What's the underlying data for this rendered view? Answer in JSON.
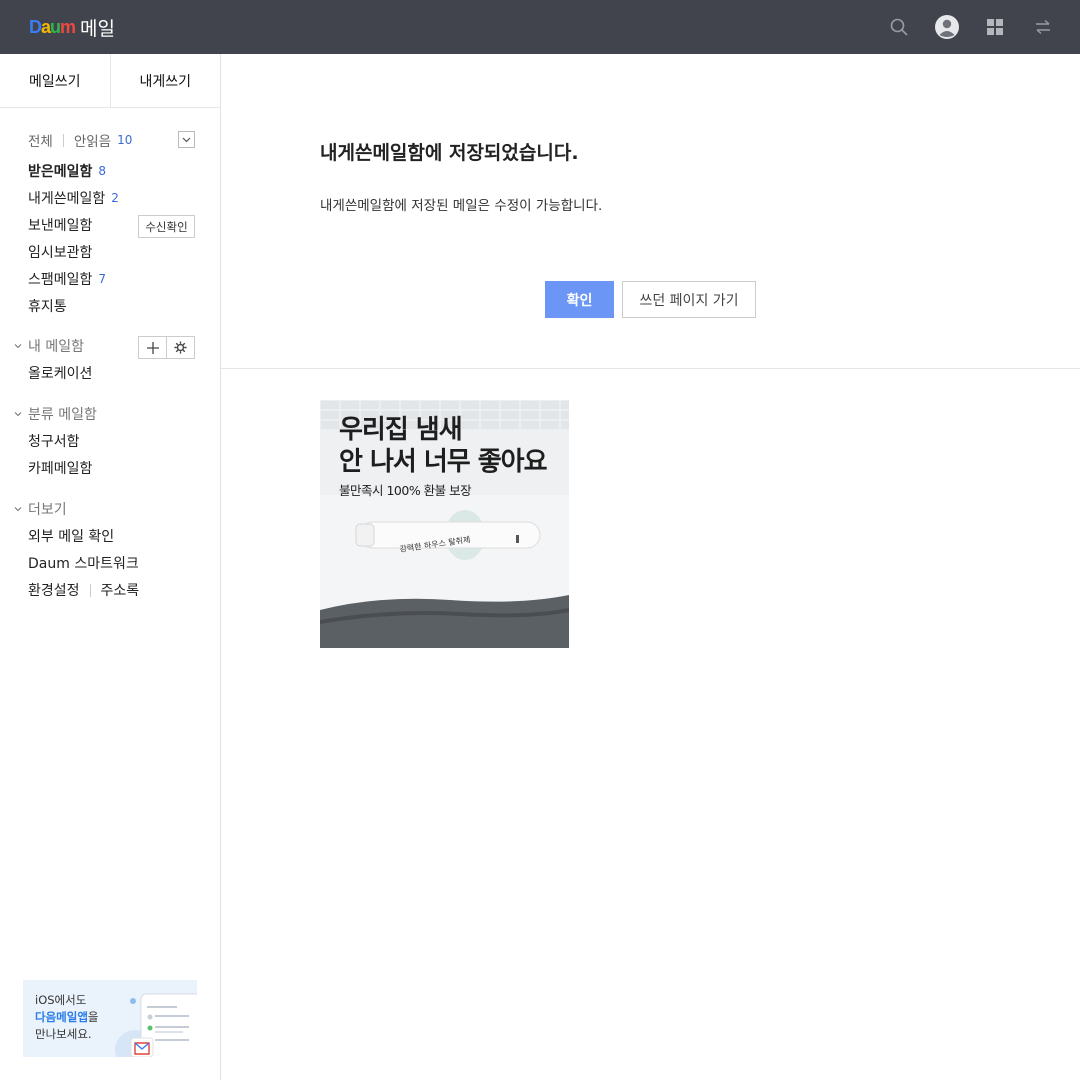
{
  "header": {
    "logo_daum": "Daum",
    "logo_mail": "메일",
    "icons": [
      "search-icon",
      "profile-icon",
      "apps-grid-icon",
      "switch-arrows-icon"
    ],
    "background": "#41444d"
  },
  "sidebar": {
    "write_mail": "메일쓰기",
    "write_self": "내게쓰기",
    "filter_all": "전체",
    "filter_unread": "안읽음",
    "unread_count": "10",
    "mailboxes": [
      {
        "label": "받은메일함",
        "count": "8"
      },
      {
        "label": "내게쓴메일함",
        "count": "2"
      },
      {
        "label": "보낸메일함",
        "count": ""
      },
      {
        "label": "임시보관함",
        "count": ""
      },
      {
        "label": "스팸메일함",
        "count": "7"
      },
      {
        "label": "휴지통",
        "count": ""
      }
    ],
    "receipt_check": "수신확인",
    "my_mailbox": "내 메일함",
    "my_items": [
      "올로케이션"
    ],
    "classified": "분류 메일함",
    "classified_items": [
      "청구서함",
      "카페메일함"
    ],
    "more": "더보기",
    "more_items": [
      "외부 메일 확인",
      "Daum 스마트워크"
    ],
    "settings": "환경설정",
    "address_book": "주소록",
    "promo": {
      "line1": "iOS에서도",
      "highlight": "다음메일앱",
      "line2_suffix": "을",
      "line3": "만나보세요."
    }
  },
  "main": {
    "title": "내게쓴메일함에 저장되었습니다.",
    "description": "내게쓴메일함에 저장된 메일은 수정이 가능합니다.",
    "confirm_button": "확인",
    "back_button": "쓰던 페이지 가기",
    "accent": "#6b96f5"
  },
  "ad": {
    "headline_1": "우리집 냄새",
    "headline_2": "안 나서 너무 좋아요",
    "subline": "불만족시 100% 환불 보장",
    "product_label": "강력한 하우스 탈취제"
  }
}
